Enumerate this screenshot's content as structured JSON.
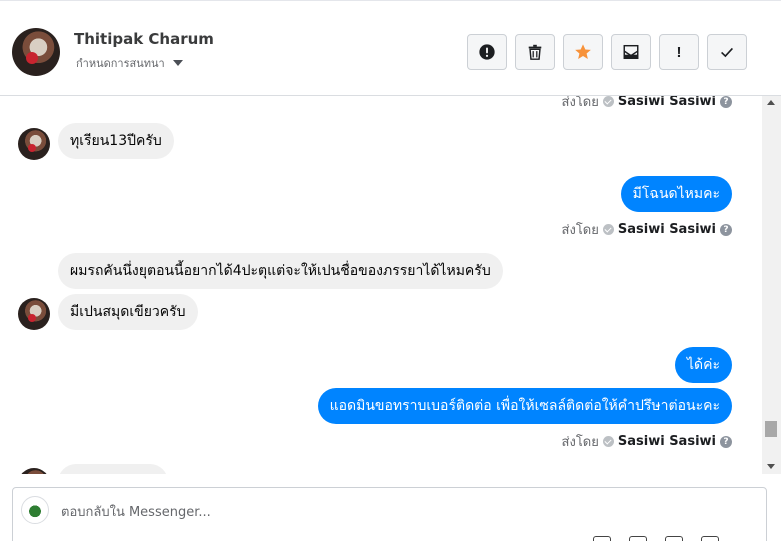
{
  "header": {
    "contact_name": "Thitipak Charum",
    "manage_label": "กำหนดการสนทนา",
    "toolbar": [
      {
        "name": "mark-spam-button",
        "icon": "exclamation-circle-icon"
      },
      {
        "name": "delete-button",
        "icon": "trash-icon"
      },
      {
        "name": "star-button",
        "icon": "star-icon"
      },
      {
        "name": "mark-unread-button",
        "icon": "envelope-icon"
      },
      {
        "name": "follow-up-button",
        "icon": "exclamation-icon",
        "text": "!"
      },
      {
        "name": "done-button",
        "icon": "check-icon"
      }
    ]
  },
  "conversation": {
    "messages": [
      {
        "id": "m1",
        "direction": "in",
        "text": "ทุเรียน13ปีครับ"
      },
      {
        "id": "m2",
        "direction": "out",
        "text": "มีโฉนดไหมคะ"
      },
      {
        "id": "m3",
        "direction": "in",
        "text": "ผมรถคันนึ่งยุตอนนี้อยากได้4ปะตุแต่จะให้เปนชื่อของภรรยาได้ไหมครับ"
      },
      {
        "id": "m4",
        "direction": "in",
        "text": "มีเปนสมุดเขียวครับ"
      },
      {
        "id": "m5",
        "direction": "out",
        "text": "ได้ค่ะ"
      },
      {
        "id": "m6",
        "direction": "out",
        "text": "แอดมินขอทราบเบอร์ติดต่อ เพื่อให้เซลล์ติดต่อให้คำปรึษาต่อนะคะ"
      }
    ],
    "sent_by_label": "ส่งโดย",
    "sent_by_name": "Sasiwi Sasiwi",
    "help_glyph": "?"
  },
  "composer": {
    "placeholder": "ตอบกลับใน Messenger..."
  },
  "colors": {
    "outgoing_bubble": "#0084ff",
    "incoming_bubble": "#f0f0f0",
    "star": "#f7923a"
  }
}
